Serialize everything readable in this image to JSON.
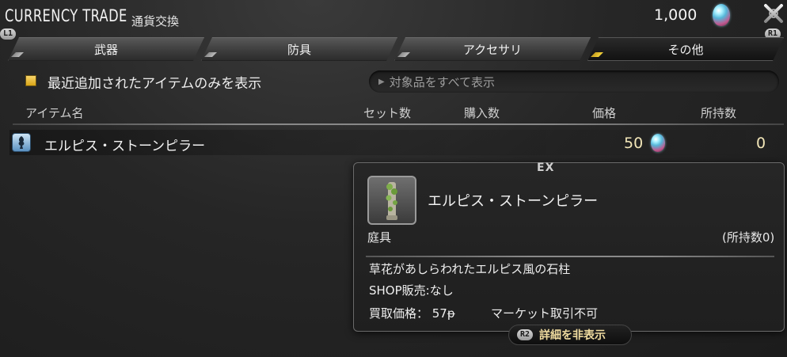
{
  "header": {
    "title": "CURRENCY TRADE",
    "subtitle": "通貨交換",
    "currency_amount": "1,000",
    "currency_icon": "gem-icon"
  },
  "buttons": {
    "l1": "L1",
    "r1": "R1",
    "r2": "R2"
  },
  "tabs": [
    {
      "label": "武器",
      "active": false
    },
    {
      "label": "防具",
      "active": false
    },
    {
      "label": "アクセサリ",
      "active": false
    },
    {
      "label": "その他",
      "active": true
    }
  ],
  "filter": {
    "checkbox_label": "最近追加されたアイテムのみを表示",
    "checked": true,
    "show_all_label": "対象品をすべて表示"
  },
  "columns": {
    "item": "アイテム名",
    "set": "セット数",
    "buy": "購入数",
    "price": "価格",
    "owned": "所持数"
  },
  "items": [
    {
      "name": "エルピス・ストーンピラー",
      "price": "50",
      "owned": "0"
    }
  ],
  "tooltip": {
    "tag": "EX",
    "name": "エルピス・ストーンピラー",
    "category": "庭具",
    "owned": "(所持数0)",
    "description": "草花があしらわれたエルピス風の石柱",
    "shop": "SHOP販売:なし",
    "sell_price": "買取価格： 57ᵽ",
    "market": "マーケット取引不可"
  },
  "hide_details": "詳細を非表示",
  "colors": {
    "accent_gold": "#f5d43a",
    "price_text": "#f2e6b8"
  }
}
